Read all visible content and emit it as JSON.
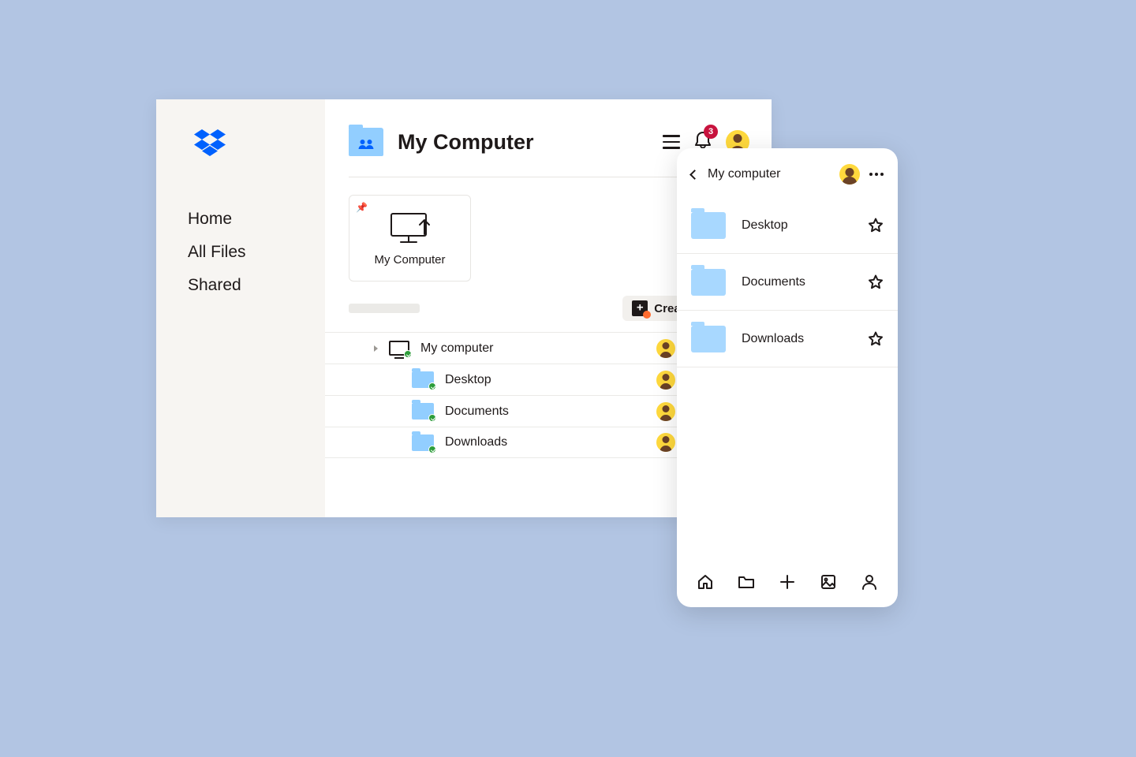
{
  "sidebar": {
    "items": [
      "Home",
      "All Files",
      "Shared"
    ]
  },
  "header": {
    "title": "My Computer",
    "notification_count": "3"
  },
  "card": {
    "label": "My Computer"
  },
  "toolbar": {
    "create_label": "Create"
  },
  "file_rows": [
    {
      "name": "My computer"
    },
    {
      "name": "Desktop"
    },
    {
      "name": "Documents"
    },
    {
      "name": "Downloads"
    }
  ],
  "mobile": {
    "title": "My computer",
    "rows": [
      {
        "name": "Desktop"
      },
      {
        "name": "Documents"
      },
      {
        "name": "Downloads"
      }
    ]
  }
}
